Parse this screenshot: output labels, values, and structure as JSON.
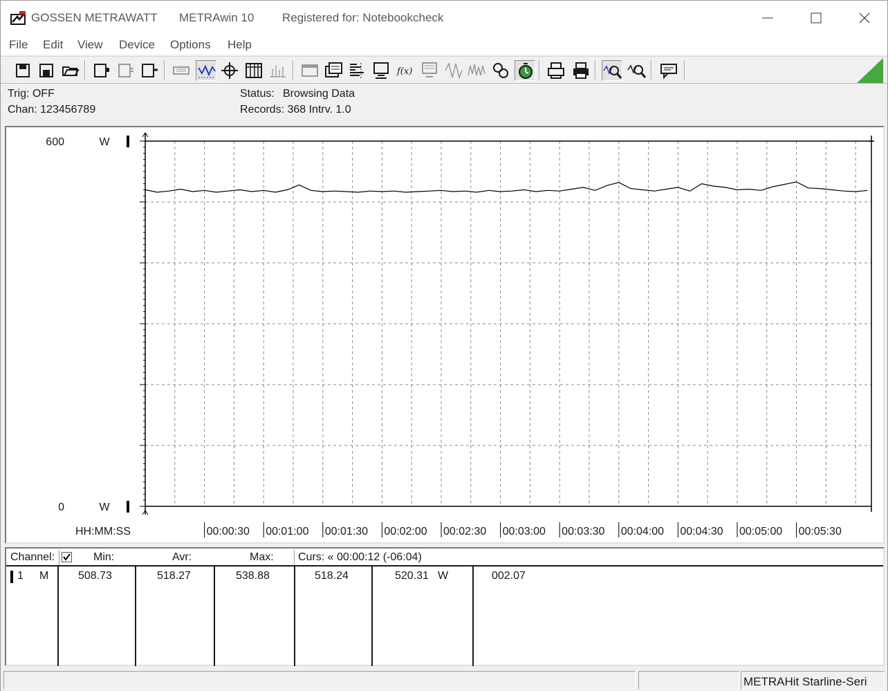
{
  "title": {
    "company": "GOSSEN METRAWATT",
    "app": "METRAwin 10",
    "registered": "Registered for: Notebookcheck"
  },
  "menu": [
    "File",
    "Edit",
    "View",
    "Device",
    "Options",
    "Help"
  ],
  "toolbar": {
    "icons": [
      "save-icon",
      "save-as-icon",
      "open-folder-icon",
      "device-connect-icon",
      "device-disabled-icon",
      "device-read-icon",
      "printer-disabled-icon",
      "trace-view-icon",
      "crosshair-icon",
      "table-view-icon",
      "histogram-icon",
      "window-disabled-icon",
      "multi-window-icon",
      "bar-list-icon",
      "computer-icon",
      "function-icon",
      "monitor-disabled-icon",
      "wave-disabled-icon",
      "noise-disabled-icon",
      "settings-icon",
      "timer-icon",
      "print-preview-icon",
      "print-icon",
      "zoom-in-icon",
      "zoom-out-icon",
      "comment-icon"
    ],
    "accent": "#46a83e"
  },
  "info": {
    "trig": "Trig: OFF",
    "chan": "Chan:  123456789",
    "status_label": "Status:",
    "status_value": "Browsing Data",
    "records": "Records: 368   Intrv. 1.0"
  },
  "chart_data": {
    "type": "line",
    "y_top_label": "600",
    "y_bottom_label": "0",
    "y_unit": "W",
    "ylim": [
      0,
      600
    ],
    "x_axis_label": "HH:MM:SS",
    "x_ticks": [
      "00:00:30",
      "00:01:00",
      "00:01:30",
      "00:02:00",
      "00:02:30",
      "00:03:00",
      "00:03:30",
      "00:04:00",
      "00:04:30",
      "00:05:00",
      "00:05:30"
    ],
    "xlim_seconds": [
      0,
      368
    ],
    "grid": true,
    "series": [
      {
        "color": "#000000",
        "x_seconds": [
          0,
          6,
          12,
          18,
          24,
          30,
          36,
          42,
          48,
          54,
          60,
          66,
          72,
          78,
          84,
          90,
          96,
          102,
          108,
          114,
          120,
          126,
          132,
          138,
          144,
          150,
          156,
          162,
          168,
          174,
          180,
          186,
          192,
          198,
          204,
          210,
          216,
          222,
          228,
          234,
          240,
          246,
          252,
          258,
          264,
          270,
          276,
          282,
          288,
          294,
          300,
          306,
          312,
          318,
          324,
          330,
          336,
          342,
          348,
          354,
          360,
          366
        ],
        "values": [
          520,
          516,
          518,
          521,
          517,
          519,
          516,
          518,
          520,
          517,
          519,
          516,
          520,
          528,
          519,
          517,
          518,
          517,
          516,
          518,
          517,
          518,
          516,
          517,
          518,
          519,
          517,
          518,
          516,
          519,
          517,
          518,
          520,
          517,
          519,
          518,
          521,
          524,
          519,
          527,
          532,
          522,
          520,
          518,
          521,
          524,
          518,
          530,
          526,
          524,
          520,
          521,
          519,
          525,
          529,
          533,
          523,
          522,
          520,
          518,
          517,
          519
        ]
      }
    ]
  },
  "table": {
    "headers": {
      "channel": "Channel:",
      "min": "Min:",
      "avr": "Avr:",
      "max": "Max:",
      "curs": "Curs: « 00:00:12 (-06:04)"
    },
    "rows": [
      {
        "index": "1",
        "mode": "M",
        "min": "508.73",
        "avr": "518.27",
        "max": "538.88",
        "cursor_value": "518.24",
        "cursor_value2": "520.31",
        "unit": "W",
        "delta": "002.07"
      }
    ]
  },
  "statusbar": {
    "device": "METRAHit Starline-Seri"
  }
}
